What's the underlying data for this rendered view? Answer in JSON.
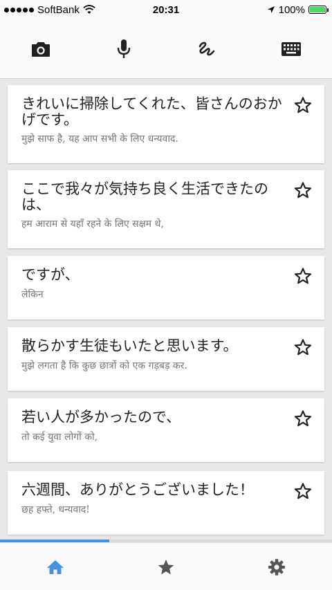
{
  "status_bar": {
    "carrier": "SoftBank",
    "time": "20:31",
    "battery": "100%"
  },
  "toolbar": {
    "icons": [
      "camera-icon",
      "microphone-icon",
      "handwriting-icon",
      "keyboard-icon"
    ]
  },
  "cards": [
    {
      "japanese": "きれいに掃除してくれた、皆さんのおかげです。",
      "hindi": "मुझे साफ है, यह आप सभी के लिए धन्यवाद."
    },
    {
      "japanese": "ここで我々が気持ち良く生活できたのは、",
      "hindi": "हम आराम से यहाँ रहने के लिए सक्षम थे,"
    },
    {
      "japanese": "ですが、",
      "hindi": "लेकिन"
    },
    {
      "japanese": "散らかす生徒もいたと思います。",
      "hindi": "मुझे लगता है कि कुछ छात्रों को एक गड़बड़ कर."
    },
    {
      "japanese": "若い人が多かったので、",
      "hindi": "तो कई युवा लोगों को,"
    },
    {
      "japanese": "六週間、ありがとうございました！",
      "hindi": "छह हफ्ते, धन्यवाद!"
    }
  ],
  "progress": {
    "value": 0.33
  },
  "colors": {
    "accent": "#4a90e2",
    "icon_dark": "#212121",
    "icon_grey": "#555555"
  },
  "bottom_nav": [
    "home-icon",
    "star-icon",
    "gear-icon"
  ]
}
